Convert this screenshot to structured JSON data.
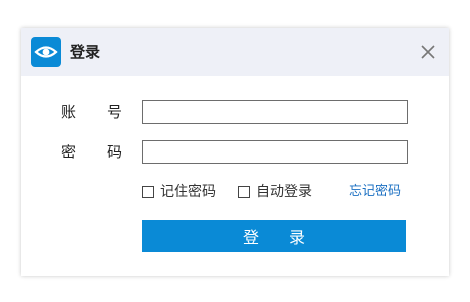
{
  "dialog": {
    "title": "登录",
    "logo_icon": "eye-icon",
    "close_icon": "close-icon",
    "accent_color": "#0a8ad6"
  },
  "form": {
    "account_label": [
      "账",
      "号"
    ],
    "password_label": [
      "密",
      "码"
    ],
    "account_value": "",
    "password_value": "",
    "remember_password": {
      "label": "记住密码",
      "checked": false
    },
    "auto_login": {
      "label": "自动登录",
      "checked": false
    },
    "forgot_password": "忘记密码",
    "login_button": "登录"
  }
}
